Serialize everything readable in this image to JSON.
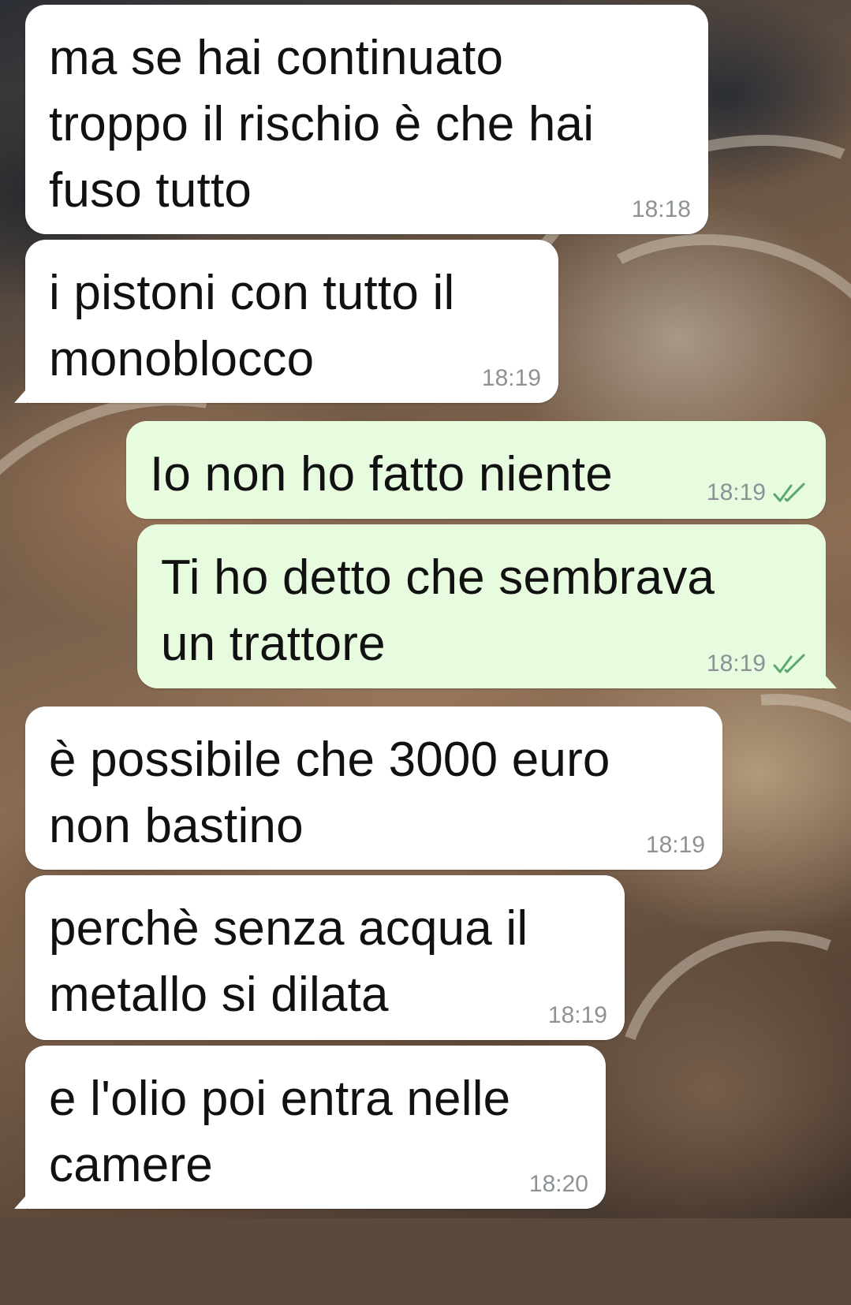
{
  "chat": {
    "colors": {
      "incoming_bubble": "#ffffff",
      "outgoing_bubble": "#e7fbdf",
      "time_text": "#8c9296",
      "read_ticks": "#5aa86b"
    },
    "messages": [
      {
        "direction": "incoming",
        "text": "ma se hai continuato\ntroppo il rischio è che hai\nfuso tutto",
        "time": "18:18"
      },
      {
        "direction": "incoming",
        "text": "i pistoni con tutto il\nmonoblocco",
        "time": "18:19"
      },
      {
        "direction": "outgoing",
        "text": "Io non ho fatto niente",
        "time": "18:19",
        "status_icon": "double-check-icon"
      },
      {
        "direction": "outgoing",
        "text": "Ti ho detto che sembrava\nun trattore",
        "time": "18:19",
        "status_icon": "double-check-icon"
      },
      {
        "direction": "incoming",
        "text": "è possibile che 3000 euro\nnon bastino",
        "time": "18:19"
      },
      {
        "direction": "incoming",
        "text": "perchè senza acqua il\nmetallo si dilata",
        "time": "18:19"
      },
      {
        "direction": "incoming",
        "text": "e l'olio poi entra nelle\ncamere",
        "time": "18:20"
      }
    ]
  }
}
